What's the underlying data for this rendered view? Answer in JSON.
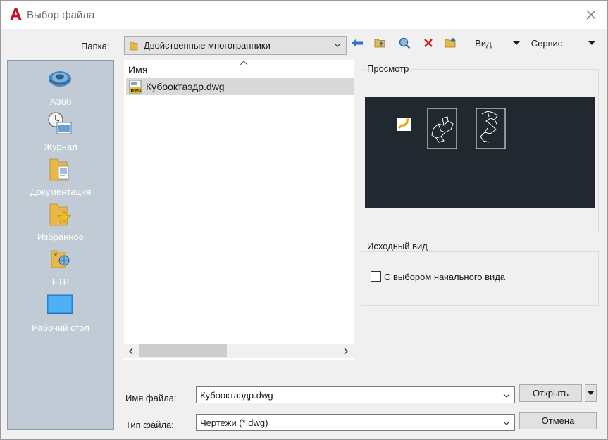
{
  "window": {
    "title": "Выбор файла",
    "close_icon": "close-icon"
  },
  "folder": {
    "label": "Папка:",
    "value": "Двойственные многогранники"
  },
  "toolbar": {
    "view_label": "Вид",
    "service_label": "Сервис",
    "icons": [
      "back-arrow-icon",
      "folder-up-icon",
      "search-web-icon",
      "delete-icon",
      "new-folder-icon"
    ]
  },
  "places": [
    {
      "label": "A360",
      "icon": "a360-icon"
    },
    {
      "label": "Журнал",
      "icon": "history-icon"
    },
    {
      "label": "Документация",
      "icon": "documents-folder-icon"
    },
    {
      "label": "Избранное",
      "icon": "favorites-folder-icon"
    },
    {
      "label": "FTP",
      "icon": "ftp-icon"
    },
    {
      "label": "Рабочий стол",
      "icon": "desktop-icon"
    }
  ],
  "filelist": {
    "column_header": "Имя",
    "files": [
      {
        "name": "Кубооктаэдр.dwg",
        "selected": true,
        "icon": "dwg-file-icon"
      }
    ]
  },
  "preview": {
    "title": "Просмотр",
    "background": "#212830"
  },
  "initial_view": {
    "title": "Исходный вид",
    "checkbox_label": "С выбором начального вида",
    "checked": false
  },
  "filename": {
    "label": "Имя файла:",
    "value": "Кубооктаэдр.dwg"
  },
  "filetype": {
    "label": "Тип файла:",
    "value": "Чертежи (*.dwg)"
  },
  "buttons": {
    "open": "Открыть",
    "cancel": "Отмена"
  },
  "colors": {
    "accent_red": "#c8102e",
    "places_bg": "#c0cbd5",
    "selection": "#d9d9d9"
  }
}
